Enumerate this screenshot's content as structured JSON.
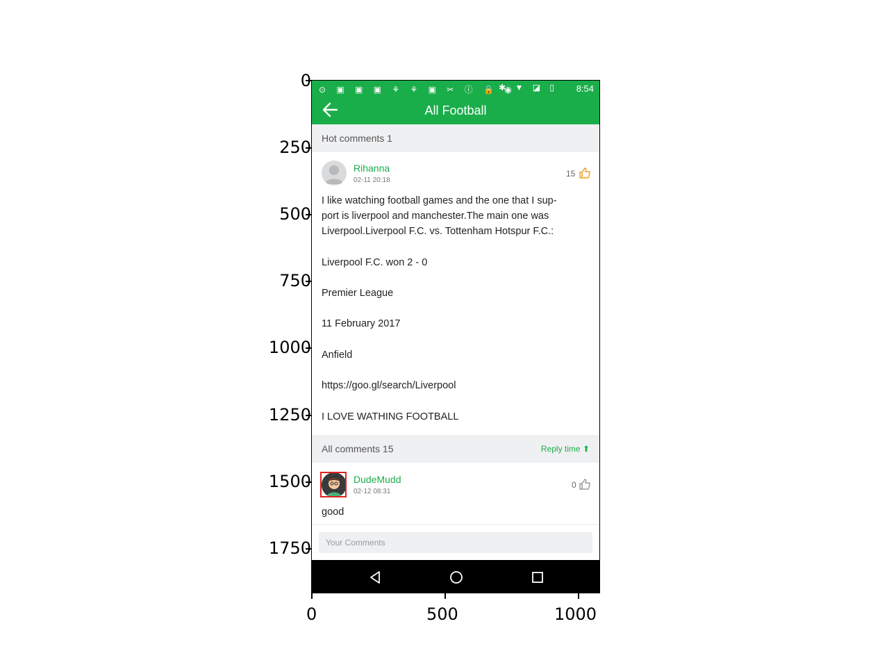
{
  "status_bar": {
    "time": "8:54",
    "left_icons": "⊙ ▣ ▣ ▣ ⚘ ⚘ ▣ ✂ ⓘ 🔒 ◉",
    "right_icons": "✱ ▼ ◪ ▯"
  },
  "app_bar": {
    "title": "All Football",
    "back_icon": "back-arrow-icon"
  },
  "hot_section": {
    "label": "Hot comments 1"
  },
  "hot_comment": {
    "user": "Rihanna",
    "date": "02-11 20:18",
    "likes": "15",
    "lines": [
      "I like watching football games and the one that I sup-",
      "port is liverpool and manchester.The main one was",
      "Liverpool.Liverpool F.C. vs. Tottenham Hotspur F.C.:",
      "Liverpool F.C. won 2 - 0",
      "Premier League",
      "11 February 2017",
      "Anfield",
      "https://goo.gl/search/Liverpool",
      "I LOVE WATHING FOOTBALL"
    ]
  },
  "all_section": {
    "label": "All comments 15",
    "sort_label": "Reply time"
  },
  "comment": {
    "user": "DudeMudd",
    "date": "02-12 08:31",
    "likes": "0",
    "text": "good"
  },
  "input": {
    "placeholder": "Your Comments"
  },
  "colors": {
    "brand": "#1aae4a",
    "highlight": "#e0211f",
    "like_active": "#f0a020"
  },
  "axes": {
    "y_ticks": [
      "0",
      "250",
      "500",
      "750",
      "1000",
      "1250",
      "1500",
      "1750"
    ],
    "x_ticks": [
      "0",
      "500",
      "1000"
    ]
  }
}
